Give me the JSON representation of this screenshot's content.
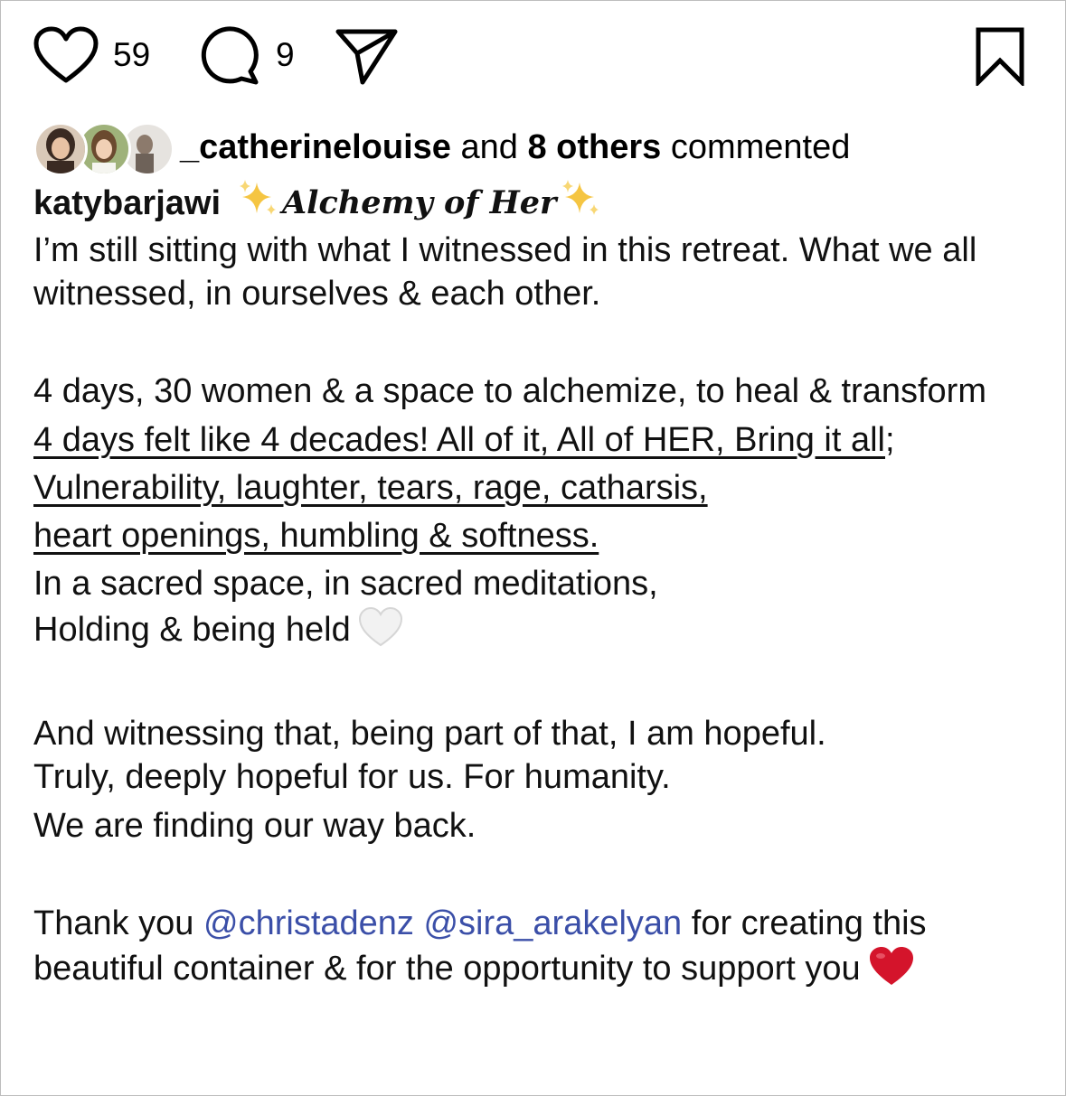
{
  "actions": {
    "like_count": "59",
    "comment_count": "9",
    "icons": [
      "heart-outline-icon",
      "comment-bubble-icon",
      "share-send-icon",
      "bookmark-icon"
    ]
  },
  "commenters": {
    "username": "_catherinelouise",
    "connector": "and",
    "others": "8 others",
    "suffix": "commented"
  },
  "caption": {
    "author": "katybarjawi",
    "title": "Alchemy of Her",
    "p1": "I’m still sitting with what I witnessed in this retreat. What we all witnessed, in ourselves & each other.",
    "p2a": "4 days, 30 women & a space to alchemize, to heal & transform",
    "ul1": "4 days felt like 4 decades! All of it, All of HER, Bring it all",
    "ul1_tail": ";",
    "ul2": "Vulnerability, laughter, tears, rage, catharsis,",
    "ul3": "heart openings, humbling & softness.",
    "p2b": "In a sacred space, in sacred meditations,",
    "p2c": "Holding & being held",
    "p3a": "And witnessing that, being part of that, I am hopeful.",
    "p3b": "Truly, deeply hopeful for us. For humanity.",
    "p3c": "We are finding our way back.",
    "p4_start": "Thank you",
    "mention1": "@christadenz",
    "mention2": "@sira_arakelyan",
    "p4_end": "for creating this beautiful container & for the opportunity to support you"
  },
  "colors": {
    "text": "#111111",
    "mention": "#3b4fa8",
    "heart_red": "#d4142b",
    "sparkle": "#f5c542"
  }
}
